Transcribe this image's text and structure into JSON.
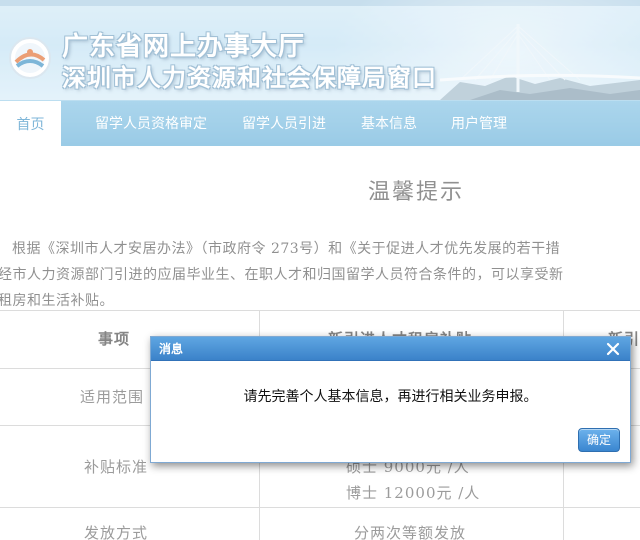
{
  "header": {
    "title_line1": "广东省网上办事大厅",
    "title_line2": "深圳市人力资源和社会保障局窗口",
    "logo_icon": "gd-government-logo-icon"
  },
  "nav": {
    "items": [
      {
        "label": "首页",
        "active": true
      },
      {
        "label": "留学人员资格审定",
        "active": false
      },
      {
        "label": "留学人员引进",
        "active": false
      },
      {
        "label": "基本信息",
        "active": false
      },
      {
        "label": "用户管理",
        "active": false
      }
    ]
  },
  "notice": {
    "heading": "温馨提示",
    "para_line1": "根据《深圳市人才安居办法》（市政府令 273号）和《关于促进人才优先发展的若干措",
    "para_line2": "经市人力资源部门引进的应届毕业生、在职人才和归国留学人员符合条件的，可以享受新",
    "para_line3": "租房和生活补贴。"
  },
  "table": {
    "header_col1": "事项",
    "header_col2": "新引进人才租房补贴",
    "header_col3": "新引",
    "row1_label": "适用范围",
    "row2_label": "补贴标准",
    "row2_value_a": "硕士 9000元 /人",
    "row2_value_b": "博士 12000元 /人",
    "row3_label": "发放方式",
    "row3_value": "分两次等额发放"
  },
  "modal": {
    "title": "消息",
    "message": "请先完善个人基本信息，再进行相关业务申报。",
    "ok_label": "确定",
    "close_icon": "close-icon"
  },
  "colors": {
    "nav_bg": "#6fb7de",
    "nav_active_text": "#3a8fc4",
    "modal_header": "#4a90d4",
    "banner_bg": "#c9e5f5"
  }
}
